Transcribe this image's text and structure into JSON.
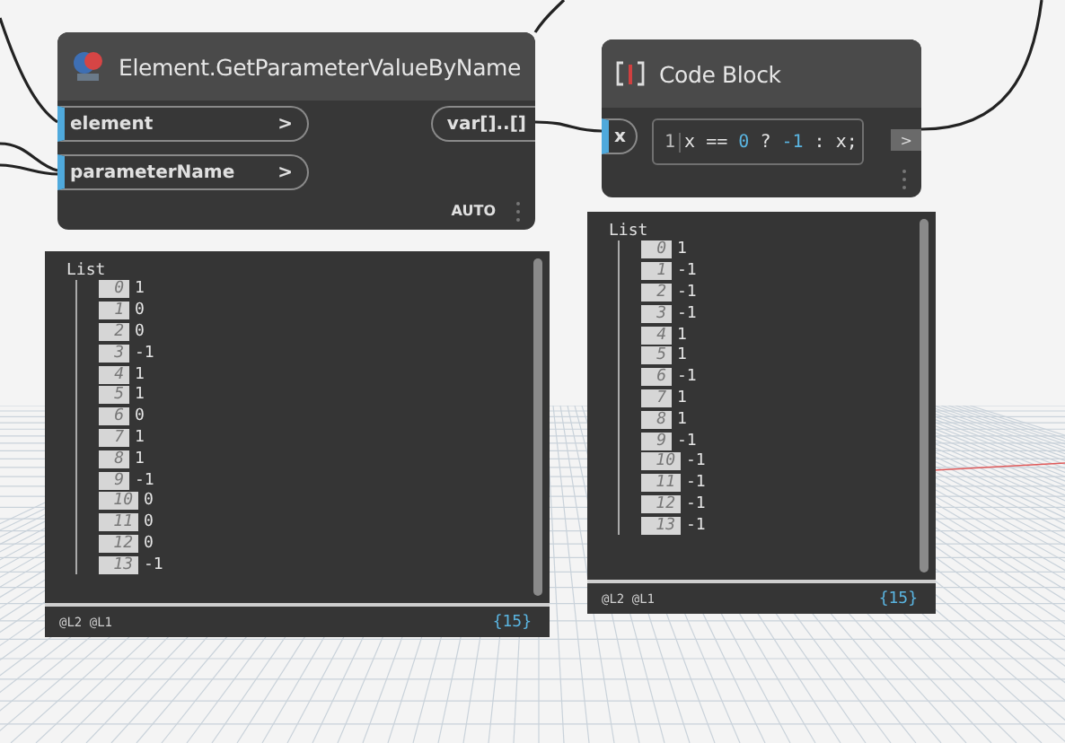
{
  "nodes": [
    {
      "kind": "function",
      "title": "Element.GetParameterValueByName",
      "inputs": [
        {
          "label": "element",
          "arrow": ">"
        },
        {
          "label": "parameterName",
          "arrow": ">"
        }
      ],
      "outputs": [
        "var[]..[]"
      ],
      "lacing": "AUTO",
      "preview": {
        "header": "List",
        "items": [
          {
            "index": "0",
            "value": "1"
          },
          {
            "index": "1",
            "value": "0"
          },
          {
            "index": "2",
            "value": "0"
          },
          {
            "index": "3",
            "value": "-1"
          },
          {
            "index": "4",
            "value": "1"
          },
          {
            "index": "5",
            "value": "1"
          },
          {
            "index": "6",
            "value": "0"
          },
          {
            "index": "7",
            "value": "1"
          },
          {
            "index": "8",
            "value": "1"
          },
          {
            "index": "9",
            "value": "-1"
          },
          {
            "index": "10",
            "value": "0"
          },
          {
            "index": "11",
            "value": "0"
          },
          {
            "index": "12",
            "value": "0"
          },
          {
            "index": "13",
            "value": "-1"
          }
        ],
        "levels": "@L2 @L1",
        "count": "{15}"
      }
    },
    {
      "kind": "code",
      "title": "Code Block",
      "inputs": [
        {
          "label": "x"
        }
      ],
      "outputs": [
        ">"
      ],
      "code": {
        "line": "1",
        "tokens": [
          {
            "kind": "plain",
            "text": "x == "
          },
          {
            "kind": "number",
            "text": "0"
          },
          {
            "kind": "plain",
            "text": " ? "
          },
          {
            "kind": "number",
            "text": "-1"
          },
          {
            "kind": "plain",
            "text": " : x;"
          }
        ]
      },
      "preview": {
        "header": "List",
        "items": [
          {
            "index": "0",
            "value": "1"
          },
          {
            "index": "1",
            "value": "-1"
          },
          {
            "index": "2",
            "value": "-1"
          },
          {
            "index": "3",
            "value": "-1"
          },
          {
            "index": "4",
            "value": "1"
          },
          {
            "index": "5",
            "value": "1"
          },
          {
            "index": "6",
            "value": "-1"
          },
          {
            "index": "7",
            "value": "1"
          },
          {
            "index": "8",
            "value": "1"
          },
          {
            "index": "9",
            "value": "-1"
          },
          {
            "index": "10",
            "value": "-1"
          },
          {
            "index": "11",
            "value": "-1"
          },
          {
            "index": "12",
            "value": "-1"
          },
          {
            "index": "13",
            "value": "-1"
          }
        ],
        "levels": "@L2 @L1",
        "count": "{15}"
      }
    }
  ]
}
